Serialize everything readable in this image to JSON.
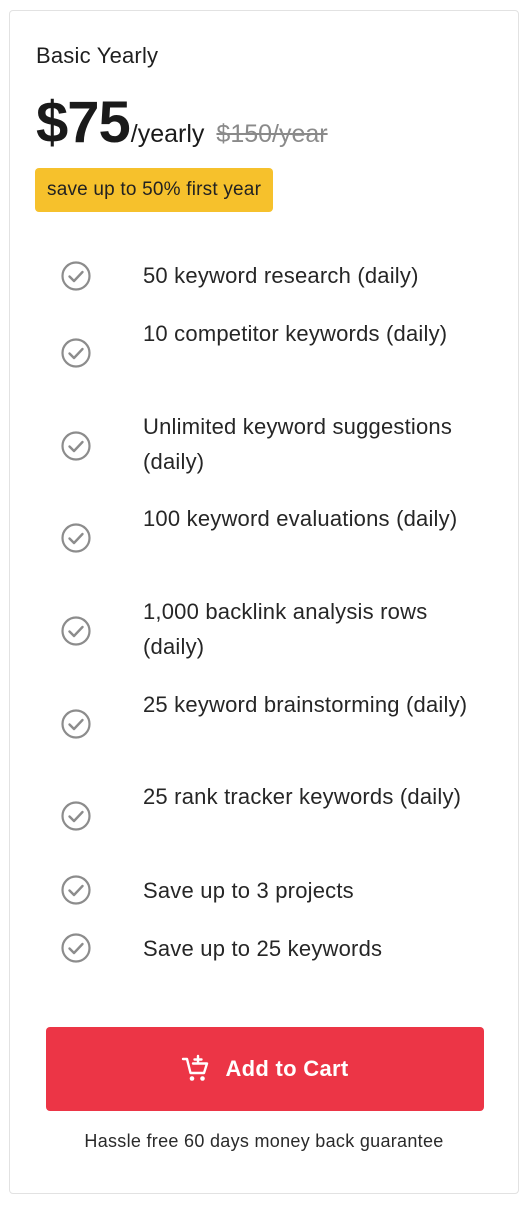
{
  "plan": {
    "name": "Basic Yearly",
    "price": "$75",
    "period": "/yearly",
    "original_price": "$150/year",
    "badge": "save up to 50% first year"
  },
  "features": [
    {
      "text": "50 keyword research (daily)",
      "icon": "check-circle-icon"
    },
    {
      "text": "10 competitor keywords (daily)",
      "icon": "check-circle-icon"
    },
    {
      "text": "Unlimited keyword suggestions (daily)",
      "icon": "check-circle-icon"
    },
    {
      "text": "100 keyword evaluations (daily)",
      "icon": "check-circle-icon"
    },
    {
      "text": "1,000 backlink analysis rows (daily)",
      "icon": "check-circle-icon"
    },
    {
      "text": "25 keyword brainstorming (daily)",
      "icon": "check-circle-icon"
    },
    {
      "text": "25 rank tracker keywords (daily)",
      "icon": "check-circle-icon"
    },
    {
      "text": "Save up to 3 projects",
      "icon": "check-circle-icon"
    },
    {
      "text": "Save up to 25 keywords",
      "icon": "check-circle-icon"
    }
  ],
  "cta": {
    "label": "Add to Cart",
    "icon": "cart-add-icon"
  },
  "guarantee": "Hassle free 60 days money back guarantee",
  "colors": {
    "accent": "#ec3546",
    "badge": "#f6c12c",
    "check": "#8c8c8c"
  }
}
